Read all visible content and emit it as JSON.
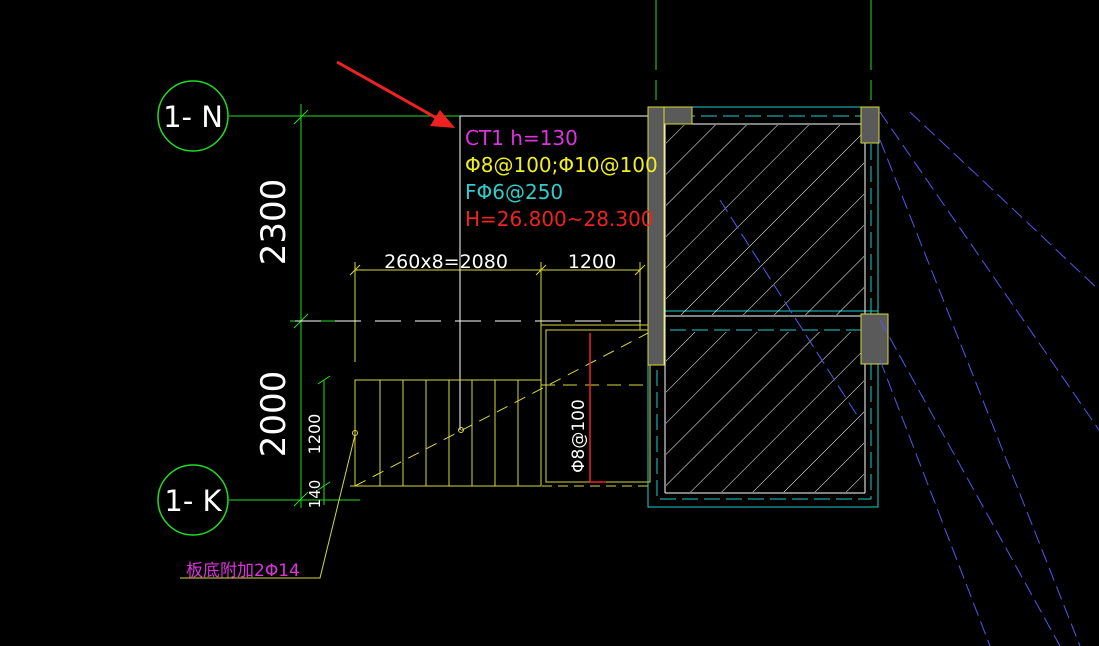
{
  "grid_axes": [
    {
      "label": "1- N"
    },
    {
      "label": "1- K"
    }
  ],
  "dimensions": {
    "d2300": "2300",
    "d2000": "2000",
    "d1200_vertical": "1200",
    "d140": "140",
    "tread": "260x8=2080",
    "landing": "1200"
  },
  "stair_annotation": {
    "ct_label": "CT1 h=130",
    "main_rebar": "Φ8@100;Φ10@100",
    "dist_rebar": "FΦ6@250",
    "elevation": "H=26.800~28.300"
  },
  "landing_rebar": "Φ8@100",
  "bottom_note": "板底附加2Φ14",
  "colors": {
    "background": "#000000",
    "axis_line": "#22dd22",
    "dimension": "#ffffff",
    "stair": "#d8d83a",
    "cyan_line": "#22cccc",
    "ct_label": "#dd33dd",
    "rebar_label": "#eeee22",
    "dist_label": "#33cccc",
    "elevation_label": "#ee2222",
    "bottom_note": "#dd33dd",
    "arrow": "#ee2222",
    "column_fill": "#5a5a5a",
    "blue_dashed": "#5555ee"
  }
}
